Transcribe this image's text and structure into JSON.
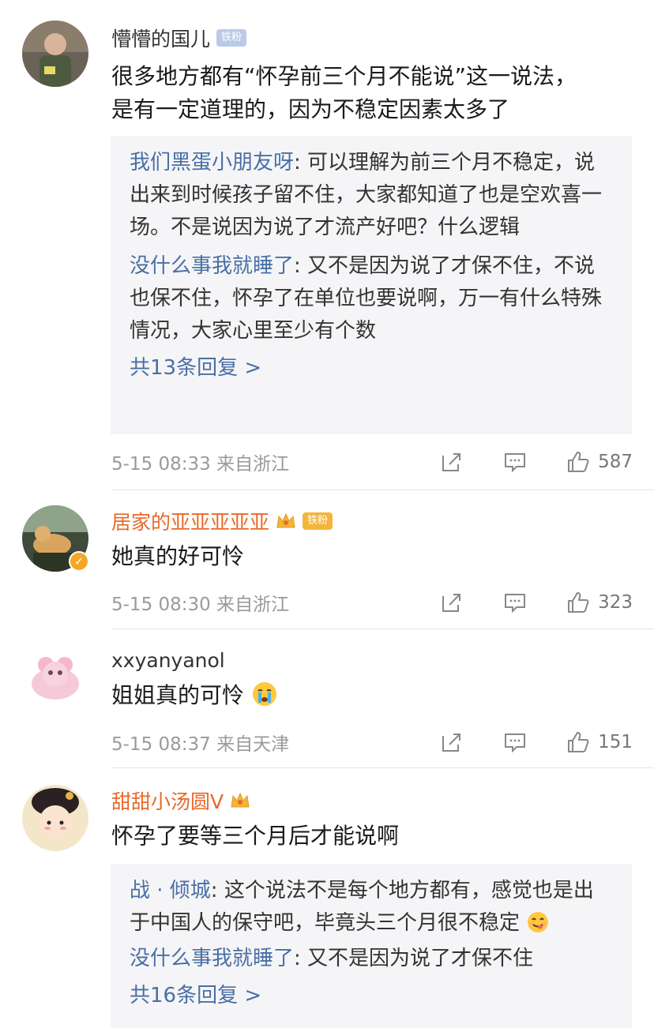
{
  "comments": [
    {
      "username": "懵懵的国儿",
      "badge": "铁粉",
      "text1": "很多地方都有“怀孕前三个月不能说”这一说法，",
      "text2": "是有一定道理的，因为不稳定因素太多了",
      "replies": [
        {
          "name": "我们黑蛋小朋友呀",
          "text": ": 可以理解为前三个月不稳定，说出来到时候孩子留不住，大家都知道了也是空欢喜一场。不是说因为说了才流产好吧？什么逻辑"
        },
        {
          "name": "没什么事我就睡了",
          "text": ": 又不是因为说了才保不住，不说也保不住，怀孕了在单位也要说啊，万一有什么特殊情况，大家心里至少有个数"
        }
      ],
      "more": "共13条回复 >",
      "meta": "5-15 08:33  来自浙江",
      "likes": "587"
    },
    {
      "username": "居家的亚亚亚亚亚",
      "badge": "铁粉",
      "text1": "她真的好可怜",
      "meta": "5-15 08:30  来自浙江",
      "likes": "323"
    },
    {
      "username": "xxyanyanol",
      "text1": "姐姐真的可怜",
      "meta": "5-15 08:37  来自天津",
      "likes": "151"
    },
    {
      "username": "甜甜小汤圆V",
      "text1": "怀孕了要等三个月后才能说啊",
      "replies": [
        {
          "name": "战 · 倾城",
          "text": ": 这个说法不是每个地方都有，感觉也是出于中国人的保守吧，毕竟头三个月很不稳定"
        },
        {
          "name": "没什么事我就睡了",
          "text": ": 又不是因为说了才保不住"
        }
      ],
      "more": "共16条回复 >"
    }
  ],
  "icons": {
    "share": "share-icon",
    "comment": "comment-icon",
    "like": "like-icon",
    "crying": "crying-emoji",
    "yummy": "yummy-emoji"
  },
  "colors": {
    "link": "#4a6fa5",
    "vip_name": "#e8692b",
    "meta": "#9a9a9a",
    "reply_bg": "#f5f5f7"
  }
}
